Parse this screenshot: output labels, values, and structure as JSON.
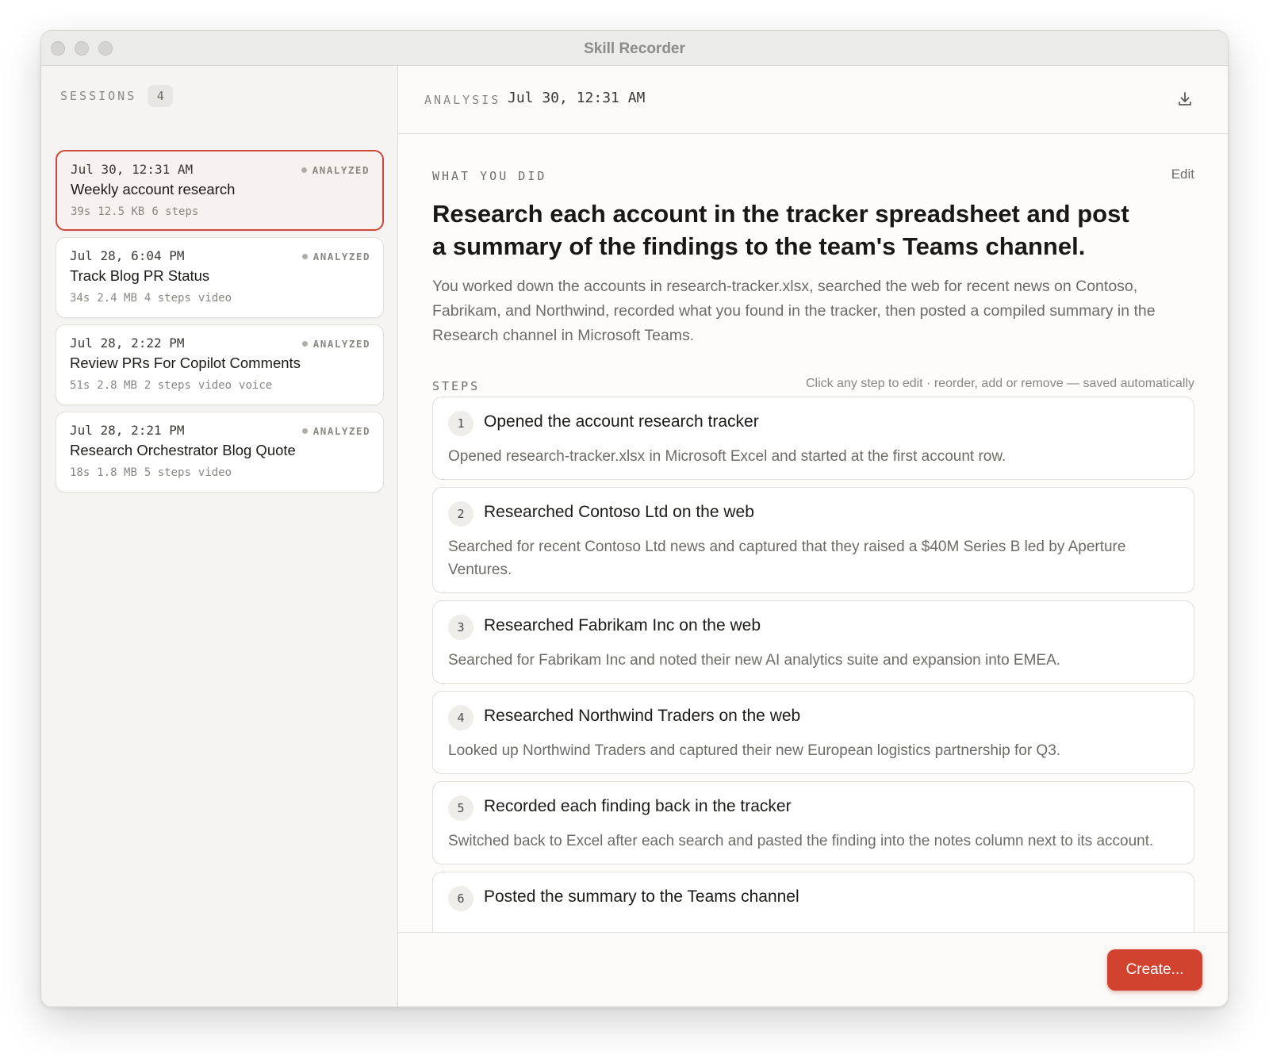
{
  "window": {
    "title": "Skill Recorder"
  },
  "sidebar": {
    "title": "SESSIONS",
    "count": "4",
    "sessions": [
      {
        "date": "Jul 30, 12:31 AM",
        "status": "ANALYZED",
        "name": "Weekly account research",
        "meta": [
          "39s",
          "12.5 KB",
          "6 steps"
        ],
        "selected": true
      },
      {
        "date": "Jul 28, 6:04 PM",
        "status": "ANALYZED",
        "name": "Track Blog PR Status",
        "meta": [
          "34s",
          "2.4 MB",
          "4 steps",
          "video"
        ],
        "selected": false
      },
      {
        "date": "Jul 28, 2:22 PM",
        "status": "ANALYZED",
        "name": "Review PRs For Copilot Comments",
        "meta": [
          "51s",
          "2.8 MB",
          "2 steps",
          "video",
          "voice"
        ],
        "selected": false
      },
      {
        "date": "Jul 28, 2:21 PM",
        "status": "ANALYZED",
        "name": "Research Orchestrator Blog Quote",
        "meta": [
          "18s",
          "1.8 MB",
          "5 steps",
          "video"
        ],
        "selected": false
      }
    ]
  },
  "analysis": {
    "label": "ANALYSIS",
    "date": "Jul 30, 12:31 AM",
    "download_icon": "download-icon"
  },
  "what_you_did": {
    "label": "WHAT YOU DID",
    "edit_label": "Edit",
    "headline": "Research each account in the tracker spreadsheet and post a summary of the findings to the team's Teams channel.",
    "summary": "You worked down the accounts in research-tracker.xlsx, searched the web for recent news on Contoso, Fabrikam, and Northwind, recorded what you found in the tracker, then posted a compiled summary in the Research channel in Microsoft Teams."
  },
  "steps": {
    "label": "STEPS",
    "hint": "Click any step to edit · reorder, add or remove — saved automatically",
    "items": [
      {
        "num": "1",
        "title": "Opened the account research tracker",
        "desc": "Opened research-tracker.xlsx in Microsoft Excel and started at the first account row."
      },
      {
        "num": "2",
        "title": "Researched Contoso Ltd on the web",
        "desc": "Searched for recent Contoso Ltd news and captured that they raised a $40M Series B led by Aperture Ventures."
      },
      {
        "num": "3",
        "title": "Researched Fabrikam Inc on the web",
        "desc": "Searched for Fabrikam Inc and noted their new AI analytics suite and expansion into EMEA."
      },
      {
        "num": "4",
        "title": "Researched Northwind Traders on the web",
        "desc": "Looked up Northwind Traders and captured their new European logistics partnership for Q3."
      },
      {
        "num": "5",
        "title": "Recorded each finding back in the tracker",
        "desc": "Switched back to Excel after each search and pasted the finding into the notes column next to its account."
      },
      {
        "num": "6",
        "title": "Posted the summary to the Teams channel",
        "desc": ""
      }
    ]
  },
  "footer": {
    "create_label": "Create..."
  },
  "colors": {
    "accent": "#d1432f",
    "selected_border": "#d0483a"
  }
}
